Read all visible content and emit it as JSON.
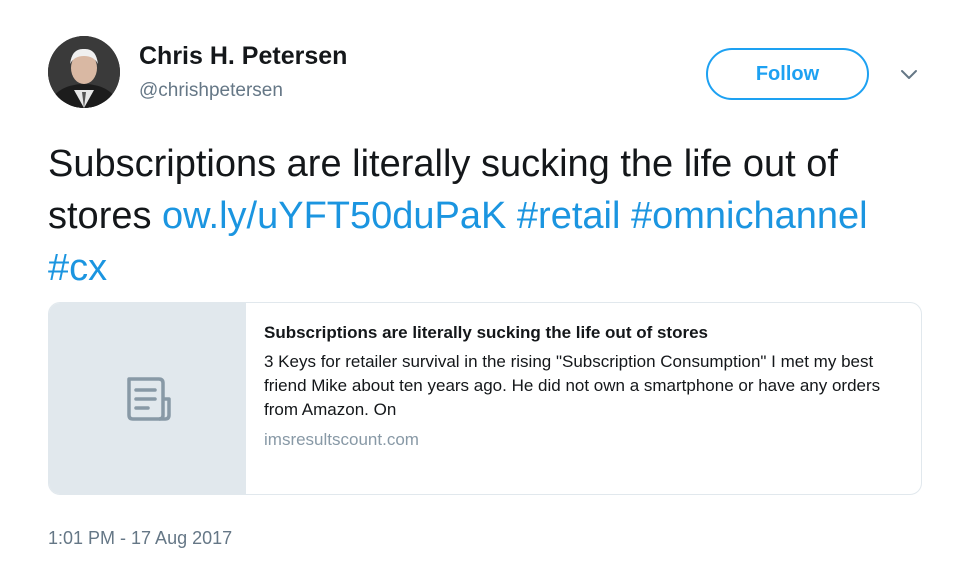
{
  "author": {
    "name": "Chris H. Petersen",
    "handle": "@chrishpetersen"
  },
  "follow_button": {
    "label": "Follow"
  },
  "menu": {
    "icon": "chevron-down-icon"
  },
  "tweet": {
    "text": "Subscriptions are literally sucking the life out of stores",
    "link": "ow.ly/uYFT50duPaK",
    "hashtags": [
      "#retail",
      "#omnichannel",
      "#cx"
    ]
  },
  "card": {
    "title": "Subscriptions are literally sucking the life out of stores",
    "description": "3 Keys for retailer survival in the rising \"Subscription Consumption\" I met my best friend Mike about ten years ago. He did not own a smartphone or have any orders from Amazon. On",
    "domain": "imsresultscount.com",
    "thumbnail_icon": "document-icon"
  },
  "timestamp": "1:01 PM - 17 Aug 2017",
  "colors": {
    "accent": "#1da1f2",
    "link": "#1b95e0",
    "muted": "#657786",
    "card_bg": "#e1e8ed"
  }
}
